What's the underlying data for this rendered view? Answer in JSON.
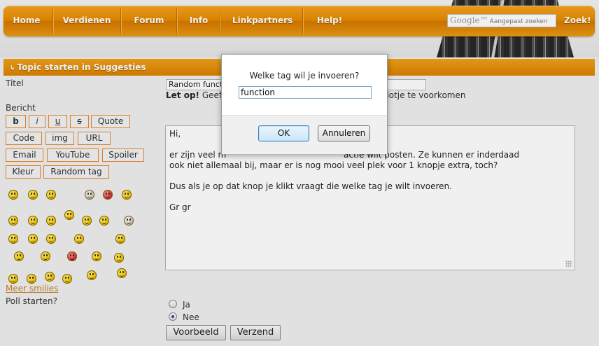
{
  "nav": {
    "items": [
      "Home",
      "Verdienen",
      "Forum",
      "Info",
      "Linkpartners",
      "Help!"
    ],
    "search_brand": "Google™",
    "search_placeholder": "Aangepast zoeken",
    "search_button": "Zoek!"
  },
  "section": {
    "title": "Topic starten in Suggesties"
  },
  "form": {
    "title_label": "Titel",
    "title_value": "Random functie",
    "warning_bold": "Let op!",
    "warning_start": "Geef",
    "warning_end": "slotje te voorkomen",
    "message_label": "Bericht",
    "bbcode": [
      "b",
      "i",
      "u",
      "s",
      "Quote",
      "Code",
      "img",
      "URL",
      "Email",
      "YouTube",
      "Spoiler",
      "Kleur",
      "Random tag"
    ],
    "more_smilies": "Meer smilies",
    "poll_label": "Poll starten?",
    "poll_yes": "Ja",
    "poll_no": "Nee",
    "poll_selected": "Nee",
    "preview_button": "Voorbeeld",
    "submit_button": "Verzend",
    "message_lines": [
      "Hi,",
      "",
      "er zijn veel m                                            actie wilt posten. Ze kunnen er inderdaad",
      "ook niet allemaal bij, maar er is nog mooi veel plek voor 1 knopje extra, toch?",
      "",
      "Dus als je op dat knop je klikt vraagt die welke tag je wilt invoeren.",
      "",
      "Gr gr"
    ]
  },
  "dialog": {
    "message": "Welke tag wil je invoeren?",
    "input_value": "function",
    "ok": "OK",
    "cancel": "Annuleren"
  },
  "colors": {
    "accent_orange": "#e58a00",
    "link_orange": "#c7802a",
    "bbcode_border": "#e68a2e"
  }
}
